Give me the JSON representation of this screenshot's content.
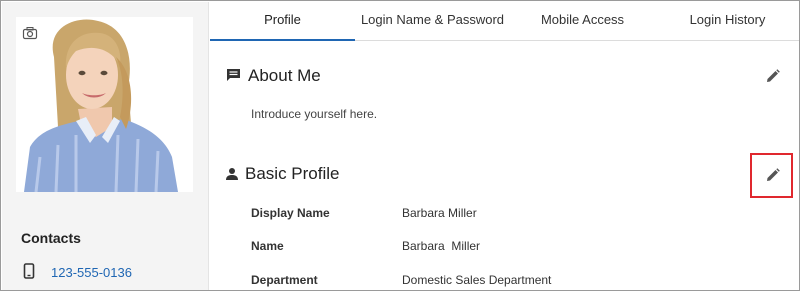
{
  "tabs": [
    {
      "label": "Profile",
      "active": true
    },
    {
      "label": "Login Name & Password",
      "active": false
    },
    {
      "label": "Mobile Access",
      "active": false
    },
    {
      "label": "Login History",
      "active": false
    }
  ],
  "sidebar": {
    "contacts_title": "Contacts",
    "phone": "123-555-0136"
  },
  "about": {
    "title": "About Me",
    "text": "Introduce yourself here."
  },
  "basic_profile": {
    "title": "Basic Profile",
    "fields": [
      {
        "label": "Display Name",
        "value": "Barbara Miller"
      },
      {
        "label": "Name",
        "value": "Barbara  Miller"
      },
      {
        "label": "Department",
        "value": "Domestic Sales Department"
      }
    ]
  },
  "colors": {
    "accent": "#1f66b3",
    "highlight": "#e0282e"
  },
  "icons": {
    "camera": "camera-icon",
    "phone": "phone-icon",
    "comment": "comment-icon",
    "person": "person-icon",
    "edit": "pencil-icon"
  }
}
